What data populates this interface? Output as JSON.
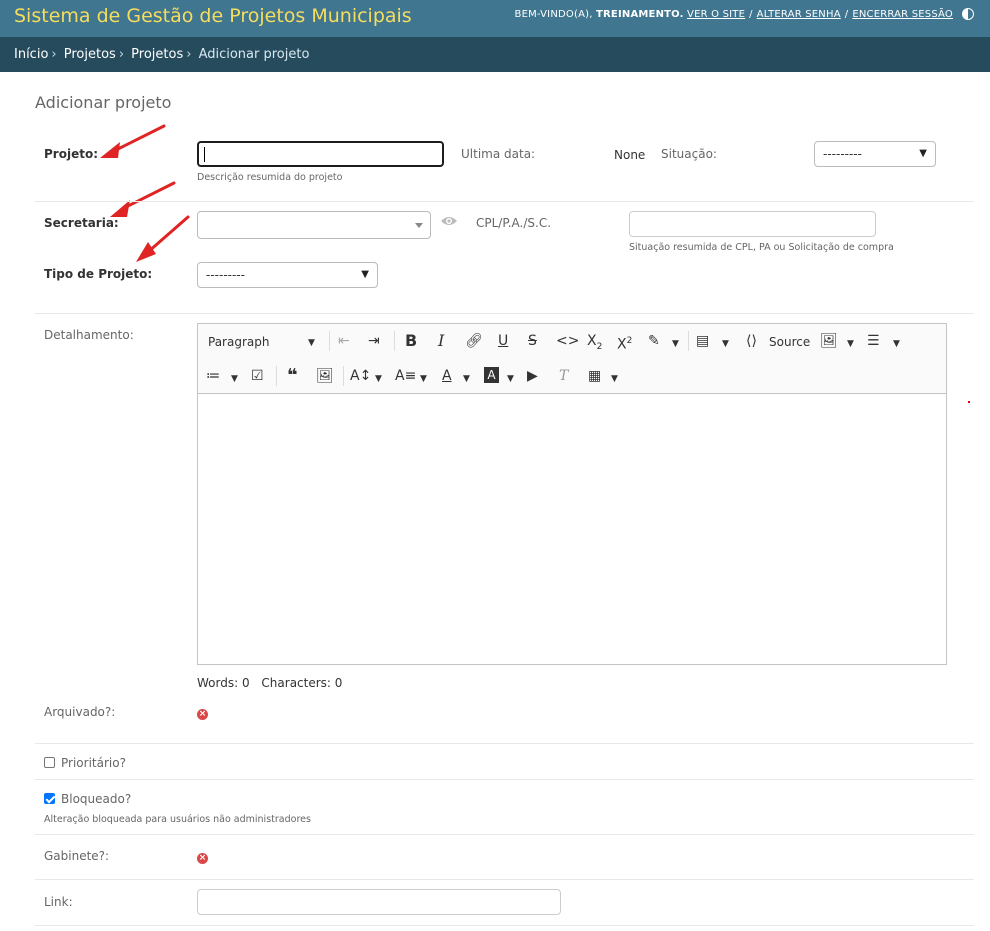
{
  "header": {
    "site_title": "Sistema de Gestão de Projetos Municipais",
    "welcome": "BEM-VINDO(A),",
    "username": "TREINAMENTO.",
    "view_site": "VER O SITE",
    "change_password": "ALTERAR SENHA",
    "logout": "ENCERRAR SESSÃO",
    "theme_icon": "half-circle-icon"
  },
  "breadcrumbs": {
    "items": [
      "Início",
      "Projetos",
      "Projetos"
    ],
    "current": "Adicionar projeto",
    "separator": "›"
  },
  "page": {
    "title": "Adicionar projeto"
  },
  "form": {
    "projeto": {
      "label": "Projeto:",
      "value": "",
      "help": "Descrição resumida do projeto"
    },
    "ultima_data": {
      "label": "Ultima data:",
      "value": "None"
    },
    "situacao": {
      "label": "Situação:",
      "selected": "---------"
    },
    "secretaria": {
      "label": "Secretaria:",
      "selected": ""
    },
    "cpl": {
      "label": "CPL/P.A./S.C.",
      "value": "",
      "help": "Situação resumida de CPL, PA ou Solicitação de compra"
    },
    "tipo_projeto": {
      "label": "Tipo de Projeto:",
      "selected": "---------"
    },
    "detalhamento": {
      "label": "Detalhamento:"
    },
    "editor": {
      "heading_select": "Paragraph",
      "source_label": "Source",
      "words": "Words: 0",
      "characters": "Characters: 0"
    },
    "arquivado": {
      "label": "Arquivado?:"
    },
    "prioritario": {
      "label": "Prioritário?",
      "checked": false
    },
    "bloqueado": {
      "label": "Bloqueado?",
      "checked": true,
      "help": "Alteração bloqueada para usuários não administradores"
    },
    "gabinete": {
      "label": "Gabinete?:"
    },
    "link": {
      "label": "Link:",
      "value": ""
    }
  },
  "colors": {
    "header_bg": "#417690",
    "title_yellow": "#f5dd5d",
    "breadcrumb_bg": "#264b5d",
    "annotation_red": "#e02424",
    "false_icon": "#dd4646",
    "checkbox_blue": "#0075ff"
  }
}
